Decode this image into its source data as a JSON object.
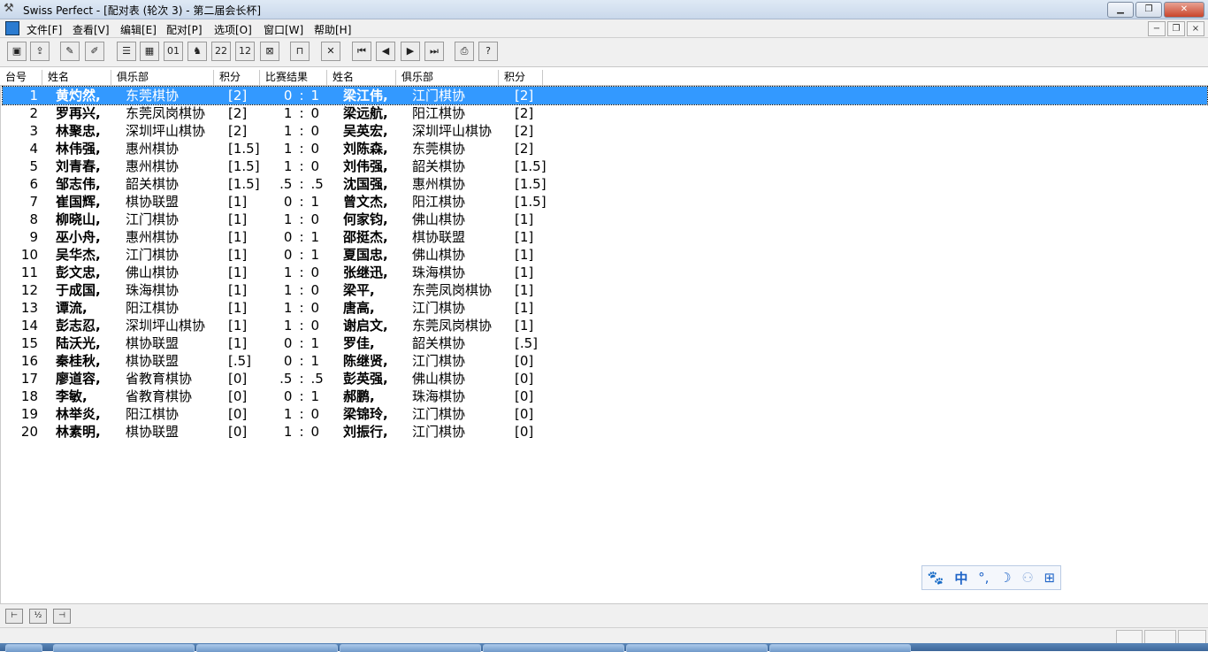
{
  "window": {
    "title": "Swiss Perfect - [配对表  (轮次 3) - 第二届会长杯]",
    "app_icon": "crossed-swords-icon",
    "controls": [
      "▁",
      "❐",
      "✕"
    ]
  },
  "menubar": {
    "items": [
      "文件[F]",
      "查看[V]",
      "编辑[E]",
      "配对[P]",
      "选项[O]",
      "窗口[W]",
      "帮助[H]"
    ],
    "mdi_controls": [
      "−",
      "❐",
      "×"
    ]
  },
  "toolbar": {
    "buttons": [
      {
        "name": "new-tournament-button",
        "glyph": "▣"
      },
      {
        "name": "open-tournament-button",
        "glyph": "⇪"
      },
      {
        "name": "edit-player-button",
        "glyph": "✎"
      },
      {
        "name": "delete-player-button",
        "glyph": "✐"
      },
      {
        "name": "player-list-button",
        "glyph": "☰"
      },
      {
        "name": "crosstable-button",
        "glyph": "▦"
      },
      {
        "name": "binary-pairing-button",
        "glyph": "01"
      },
      {
        "name": "chess-piece-button",
        "glyph": "♞"
      },
      {
        "name": "rating-2285-button",
        "glyph": "22"
      },
      {
        "name": "rating-1236-button",
        "glyph": "12"
      },
      {
        "name": "export-button",
        "glyph": "⊠"
      },
      {
        "name": "table-view-button",
        "glyph": "⊓"
      },
      {
        "name": "cancel-pairing-button",
        "glyph": "✕"
      },
      {
        "name": "first-round-button",
        "glyph": "⏮"
      },
      {
        "name": "prev-round-button",
        "glyph": "◀"
      },
      {
        "name": "next-round-button",
        "glyph": "▶"
      },
      {
        "name": "last-round-button",
        "glyph": "⏭"
      },
      {
        "name": "print-button",
        "glyph": "⎙"
      },
      {
        "name": "help-button",
        "glyph": "?"
      }
    ]
  },
  "columns": {
    "board": "台号",
    "name1": "姓名",
    "club1": "俱乐部",
    "score1": "积分",
    "result": "比赛结果",
    "name2": "姓名",
    "club2": "俱乐部",
    "score2": "积分"
  },
  "pairings": [
    {
      "board": "1",
      "name1": "黄灼然,",
      "club1": "东莞棋协",
      "score1": "[2]",
      "r1": "0",
      "r2": "1",
      "name2": "梁江伟,",
      "club2": "江门棋协",
      "score2": "[2]"
    },
    {
      "board": "2",
      "name1": "罗再兴,",
      "club1": "东莞凤岗棋协",
      "score1": "[2]",
      "r1": "1",
      "r2": "0",
      "name2": "梁远航,",
      "club2": "阳江棋协",
      "score2": "[2]"
    },
    {
      "board": "3",
      "name1": "林聚忠,",
      "club1": "深圳坪山棋协",
      "score1": "[2]",
      "r1": "1",
      "r2": "0",
      "name2": "吴英宏,",
      "club2": "深圳坪山棋协",
      "score2": "[2]"
    },
    {
      "board": "4",
      "name1": "林伟强,",
      "club1": "惠州棋协",
      "score1": "[1.5]",
      "r1": "1",
      "r2": "0",
      "name2": "刘陈森,",
      "club2": "东莞棋协",
      "score2": "[2]"
    },
    {
      "board": "5",
      "name1": "刘青春,",
      "club1": "惠州棋协",
      "score1": "[1.5]",
      "r1": "1",
      "r2": "0",
      "name2": "刘伟强,",
      "club2": "韶关棋协",
      "score2": "[1.5]"
    },
    {
      "board": "6",
      "name1": "邹志伟,",
      "club1": "韶关棋协",
      "score1": "[1.5]",
      "r1": ".5",
      "r2": ".5",
      "name2": "沈国强,",
      "club2": "惠州棋协",
      "score2": "[1.5]"
    },
    {
      "board": "7",
      "name1": "崔国辉,",
      "club1": "棋协联盟",
      "score1": "[1]",
      "r1": "0",
      "r2": "1",
      "name2": "曾文杰,",
      "club2": "阳江棋协",
      "score2": "[1.5]"
    },
    {
      "board": "8",
      "name1": "柳晓山,",
      "club1": "江门棋协",
      "score1": "[1]",
      "r1": "1",
      "r2": "0",
      "name2": "何家钧,",
      "club2": "佛山棋协",
      "score2": "[1]"
    },
    {
      "board": "9",
      "name1": "巫小舟,",
      "club1": "惠州棋协",
      "score1": "[1]",
      "r1": "0",
      "r2": "1",
      "name2": "邵挺杰,",
      "club2": "棋协联盟",
      "score2": "[1]"
    },
    {
      "board": "10",
      "name1": "吴华杰,",
      "club1": "江门棋协",
      "score1": "[1]",
      "r1": "0",
      "r2": "1",
      "name2": "夏国忠,",
      "club2": "佛山棋协",
      "score2": "[1]"
    },
    {
      "board": "11",
      "name1": "彭文忠,",
      "club1": "佛山棋协",
      "score1": "[1]",
      "r1": "1",
      "r2": "0",
      "name2": "张继迅,",
      "club2": "珠海棋协",
      "score2": "[1]"
    },
    {
      "board": "12",
      "name1": "于成国,",
      "club1": "珠海棋协",
      "score1": "[1]",
      "r1": "1",
      "r2": "0",
      "name2": "梁平,",
      "club2": "东莞凤岗棋协",
      "score2": "[1]"
    },
    {
      "board": "13",
      "name1": "谭流,",
      "club1": "阳江棋协",
      "score1": "[1]",
      "r1": "1",
      "r2": "0",
      "name2": "唐高,",
      "club2": "江门棋协",
      "score2": "[1]"
    },
    {
      "board": "14",
      "name1": "彭志忍,",
      "club1": "深圳坪山棋协",
      "score1": "[1]",
      "r1": "1",
      "r2": "0",
      "name2": "谢启文,",
      "club2": "东莞凤岗棋协",
      "score2": "[1]"
    },
    {
      "board": "15",
      "name1": "陆沃光,",
      "club1": "棋协联盟",
      "score1": "[1]",
      "r1": "0",
      "r2": "1",
      "name2": "罗佳,",
      "club2": "韶关棋协",
      "score2": "[.5]"
    },
    {
      "board": "16",
      "name1": "秦桂秋,",
      "club1": "棋协联盟",
      "score1": "[.5]",
      "r1": "0",
      "r2": "1",
      "name2": "陈继贤,",
      "club2": "江门棋协",
      "score2": "[0]"
    },
    {
      "board": "17",
      "name1": "廖道容,",
      "club1": "省教育棋协",
      "score1": "[0]",
      "r1": ".5",
      "r2": ".5",
      "name2": "彭英强,",
      "club2": "佛山棋协",
      "score2": "[0]"
    },
    {
      "board": "18",
      "name1": "李敏,",
      "club1": "省教育棋协",
      "score1": "[0]",
      "r1": "0",
      "r2": "1",
      "name2": "郝鹏,",
      "club2": "珠海棋协",
      "score2": "[0]"
    },
    {
      "board": "19",
      "name1": "林举炎,",
      "club1": "阳江棋协",
      "score1": "[0]",
      "r1": "1",
      "r2": "0",
      "name2": "梁锦玲,",
      "club2": "江门棋协",
      "score2": "[0]"
    },
    {
      "board": "20",
      "name1": "林素明,",
      "club1": "棋协联盟",
      "score1": "[0]",
      "r1": "1",
      "r2": "0",
      "name2": "刘振行,",
      "club2": "江门棋协",
      "score2": "[0]"
    }
  ],
  "selected_board": "1",
  "ime_toolbar": {
    "items": [
      {
        "name": "paw-icon",
        "glyph": "🐾"
      },
      {
        "name": "chinese-mode-icon",
        "glyph": "中"
      },
      {
        "name": "punctuation-icon",
        "glyph": "°,"
      },
      {
        "name": "moon-icon",
        "glyph": "☽"
      },
      {
        "name": "user-icon",
        "glyph": "⚇"
      },
      {
        "name": "grid-icon",
        "glyph": "⊞"
      }
    ]
  },
  "bottom_buttons": [
    "⊢",
    "½",
    "⊣"
  ],
  "colors": {
    "selection": "#3399ff",
    "ime_blue": "#1d63c7"
  }
}
